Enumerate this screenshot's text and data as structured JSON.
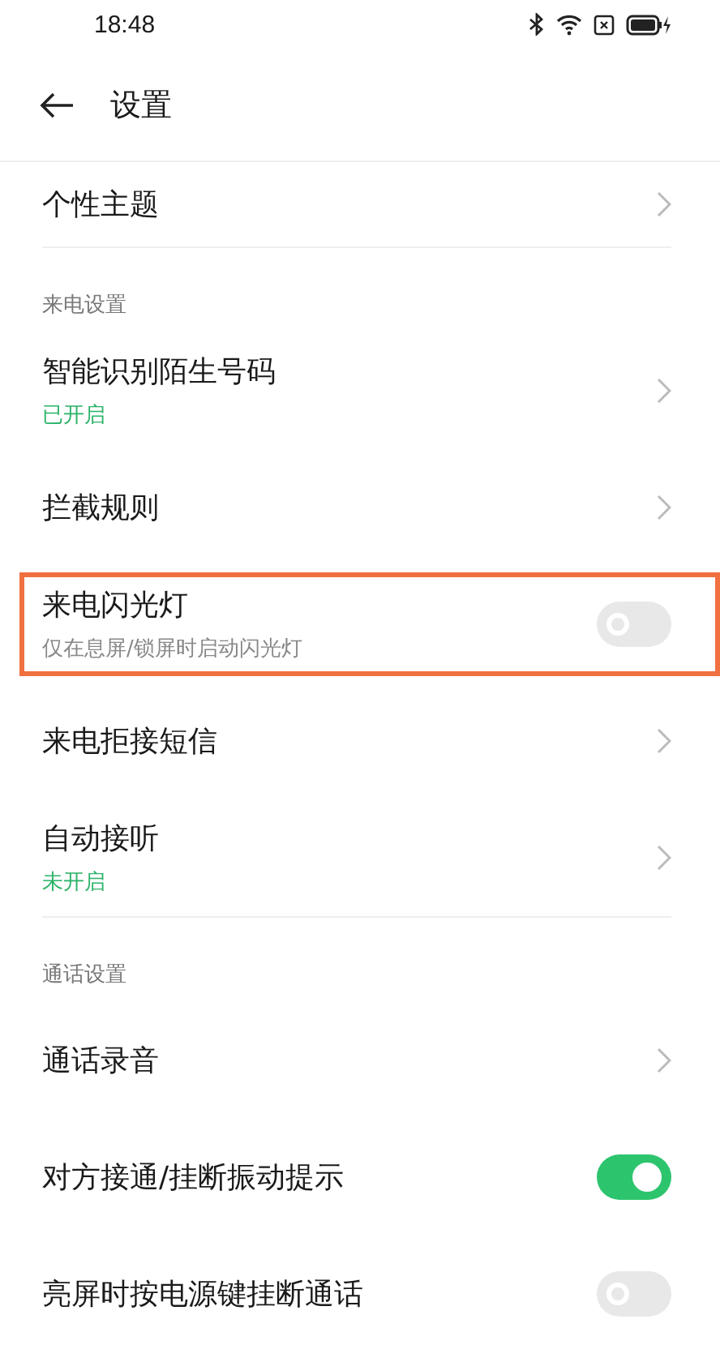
{
  "status_bar": {
    "time": "18:48"
  },
  "header": {
    "title": "设置"
  },
  "sections": [
    {
      "items": [
        {
          "kind": "link",
          "title": "个性主题"
        }
      ]
    },
    {
      "title": "来电设置",
      "items": [
        {
          "kind": "link",
          "title": "智能识别陌生号码",
          "subtitle": {
            "kind": "status",
            "text": "已开启"
          }
        },
        {
          "kind": "link",
          "title": "拦截规则"
        },
        {
          "kind": "toggle",
          "title": "来电闪光灯",
          "subtitle": {
            "kind": "description",
            "text": "仅在息屏/锁屏时启动闪光灯"
          },
          "on": false,
          "highlighted": true
        },
        {
          "kind": "link",
          "title": "来电拒接短信"
        },
        {
          "kind": "link",
          "title": "自动接听",
          "subtitle": {
            "kind": "status",
            "text": "未开启"
          }
        }
      ]
    },
    {
      "title": "通话设置",
      "items": [
        {
          "kind": "link",
          "title": "通话录音"
        },
        {
          "kind": "toggle",
          "title": "对方接通/挂断振动提示",
          "on": true
        },
        {
          "kind": "toggle",
          "title": "亮屏时按电源键挂断通话",
          "on": false
        }
      ]
    }
  ]
}
